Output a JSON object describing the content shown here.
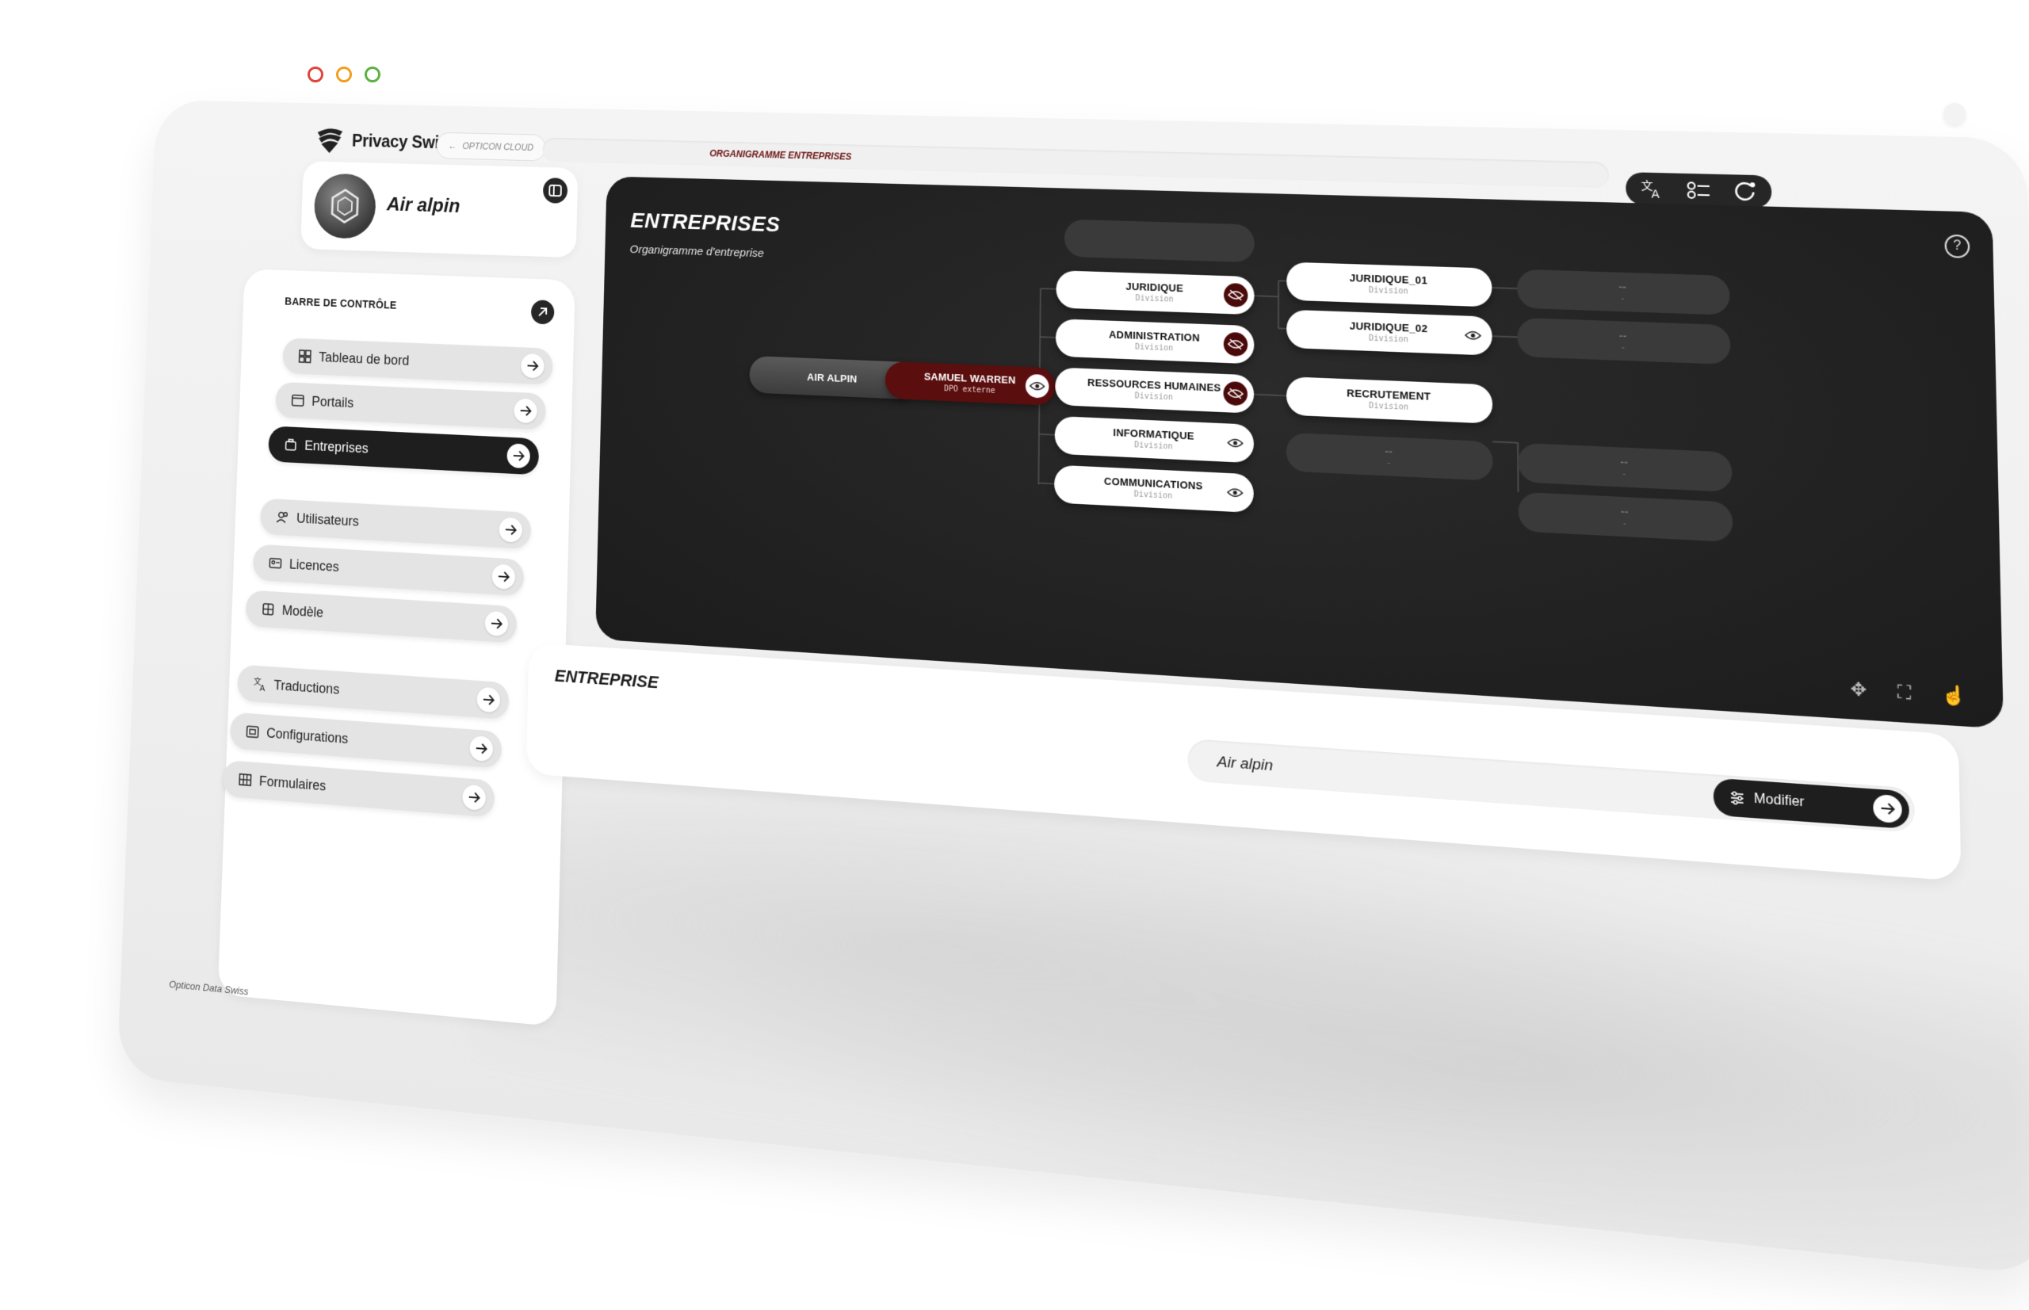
{
  "brand": {
    "name": "Privacy Swiss"
  },
  "topbar": {
    "back_label": "OPTICON CLOUD",
    "breadcrumb": "ORGANIGRAMME ENTREPRISES",
    "tools": [
      "translate-icon",
      "settings-icon",
      "refresh-icon"
    ]
  },
  "account": {
    "name": "Air alpin"
  },
  "sidebar": {
    "title": "BARRE DE CONTRÔLE",
    "items": [
      {
        "label": "Tableau de bord",
        "icon": "dashboard-icon",
        "active": false
      },
      {
        "label": "Portails",
        "icon": "window-icon",
        "active": false
      },
      {
        "label": "Entreprises",
        "icon": "briefcase-icon",
        "active": true
      },
      {
        "label": "Utilisateurs",
        "icon": "users-icon",
        "active": false
      },
      {
        "label": "Licences",
        "icon": "id-card-icon",
        "active": false
      },
      {
        "label": "Modèle",
        "icon": "template-icon",
        "active": false
      },
      {
        "label": "Traductions",
        "icon": "translate-icon",
        "active": false
      },
      {
        "label": "Configurations",
        "icon": "config-icon",
        "active": false
      },
      {
        "label": "Formulaires",
        "icon": "grid-icon",
        "active": false
      }
    ],
    "footer": "Opticon Data Swiss"
  },
  "org": {
    "title": "ENTREPRISES",
    "subtitle": "Organigramme d'entreprise",
    "root": {
      "title": "AIR ALPIN"
    },
    "dpo": {
      "title": "SAMUEL WARREN",
      "sub": "DPO externe"
    },
    "divisions": [
      {
        "title": "JURIDIQUE",
        "sub": "Division",
        "hidden": true
      },
      {
        "title": "ADMINISTRATION",
        "sub": "Division",
        "hidden": true
      },
      {
        "title": "RESSOURCES HUMAINES",
        "sub": "Division",
        "hidden": true
      },
      {
        "title": "INFORMATIQUE",
        "sub": "Division",
        "hidden": false
      },
      {
        "title": "COMMUNICATIONS",
        "sub": "Division",
        "hidden": false
      }
    ],
    "subdivisions": [
      {
        "title": "JURIDIQUE_01",
        "sub": "Division"
      },
      {
        "title": "JURIDIQUE_02",
        "sub": "Division"
      },
      {
        "title": "RECRUTEMENT",
        "sub": "Division"
      }
    ],
    "placeholders": [
      {
        "title": "--",
        "sub": "-"
      },
      {
        "title": "--",
        "sub": "-"
      },
      {
        "title": "--",
        "sub": "-"
      },
      {
        "title": "--",
        "sub": "-"
      },
      {
        "title": "--",
        "sub": "-"
      }
    ]
  },
  "entreprise": {
    "title": "ENTREPRISE",
    "value": "Air alpin",
    "modify_label": "Modifier"
  }
}
